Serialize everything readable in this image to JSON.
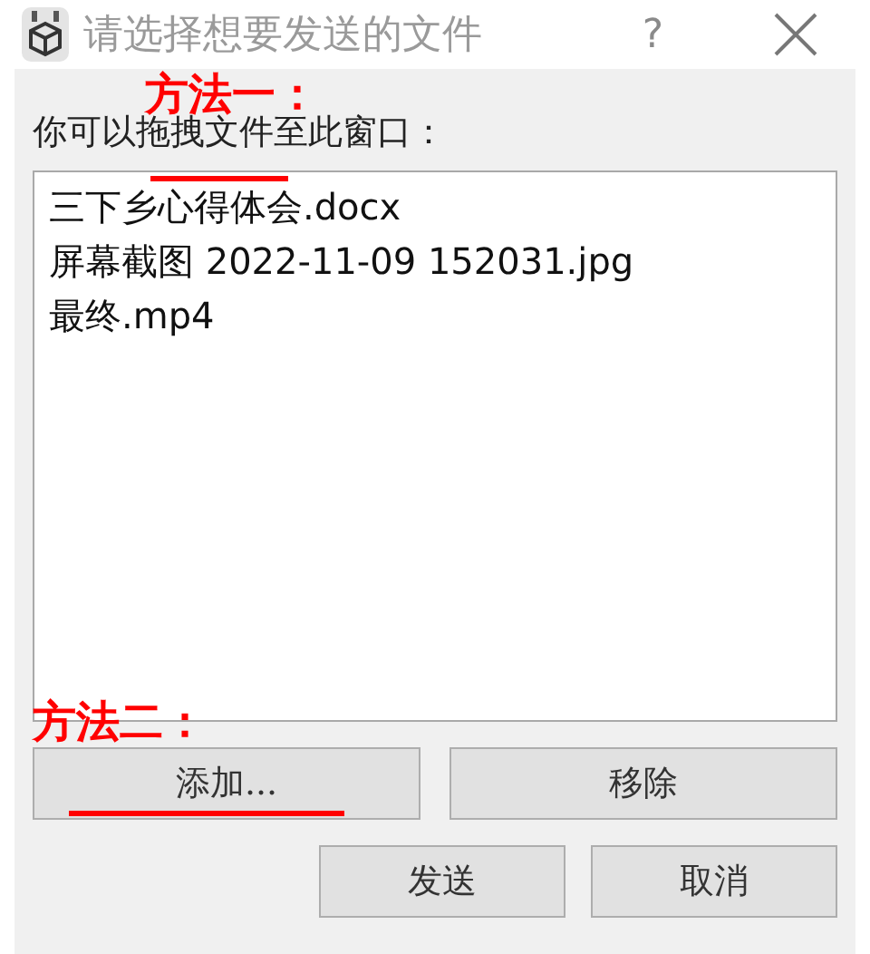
{
  "window": {
    "title": "请选择想要发送的文件",
    "help": "?"
  },
  "instruction": "你可以拖拽文件至此窗口：",
  "files": [
    "三下乡心得体会.docx",
    "屏幕截图 2022-11-09 152031.jpg",
    "最终.mp4"
  ],
  "buttons": [
    {
      "label": "添加..."
    },
    {
      "label": "移除"
    }
  ],
  "dialog_buttons": [
    {
      "label": "发送"
    },
    {
      "label": "取消"
    }
  ],
  "annotations": [
    "方法一：",
    "方法二："
  ]
}
